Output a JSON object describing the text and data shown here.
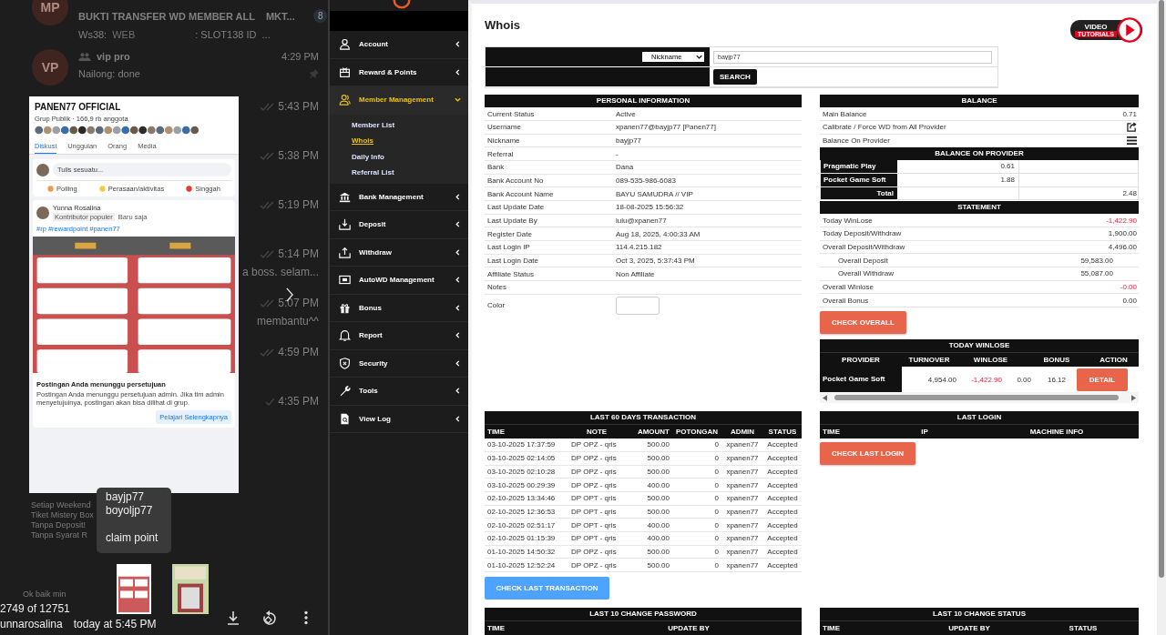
{
  "viewer": {
    "chats": [
      {
        "avatar": "MP",
        "title": "BUKTI TRANSFER WD MEMBER ALL",
        "title_2": "MKT...",
        "badge": "8",
        "preview": [
          "Ws38:",
          "WEB",
          ": SLOT138 ID",
          "..."
        ]
      },
      {
        "avatar": "VP",
        "title": "vip pro",
        "time": "4:29 PM",
        "preview": [
          "Nailong: done"
        ]
      }
    ],
    "messages": [
      {
        "time": "5:43 PM",
        "read": true
      },
      {
        "time": "5:38 PM",
        "read": true
      },
      {
        "time": "5:19 PM",
        "read": true
      },
      {
        "time": "5:14 PM",
        "read": true,
        "text": "a boss. selam..."
      },
      {
        "time": "5:07 PM",
        "read": true,
        "text": "membantu^^"
      },
      {
        "time": "4:59 PM",
        "read": true
      },
      {
        "time": "4:35 PM",
        "read": false
      }
    ],
    "behind_lines": [
      "Setiap Weekend",
      "Tiket Mistery Box",
      "Tanpa Deposit!",
      "Tanpa Syarat R"
    ],
    "reply": "Ok baik min",
    "post": {
      "group": "PANEN77 OFFICIAL",
      "meta": "Grup Publik · 166,9 rb anggota",
      "tabs": [
        {
          "label": "Diskusi",
          "selected": true
        },
        {
          "label": "Unggulan",
          "selected": false
        },
        {
          "label": "Orang",
          "selected": false
        },
        {
          "label": "Media",
          "selected": false
        }
      ],
      "composer": "Tulis sesuatu...",
      "actions": [
        {
          "label": "Polling",
          "kind": "poll"
        },
        {
          "label": "Perasaan/aktivitas",
          "kind": "feeling"
        },
        {
          "label": "Singgah",
          "kind": "location"
        }
      ],
      "author": "Yunna Rosalina",
      "badge": "Kontributor populer",
      "when": "Baru saja",
      "tags": "#rp #rewardpoint #panen77",
      "notice_title": "Postingan Anda menunggu persetujuan",
      "notice_text": "Postingan Anda menunggu persetujuan admin. Jika tim admin menyetujuinya, postingan akan bisa dilihat di grup.",
      "notice_button": "Pelajari Selengkapnya"
    },
    "caption_lines": [
      "bayjp77",
      "boyoljp77"
    ],
    "caption_note": "claim point",
    "counter": "2749 of 12751",
    "author": "unnarosalina",
    "date": "today at 5:45 PM"
  },
  "sidebar": {
    "items": [
      {
        "label": "Account",
        "kind": "account",
        "expanded": false
      },
      {
        "label": "Reward & Points",
        "kind": "reward",
        "expanded": false
      },
      {
        "label": "Member Management",
        "kind": "members",
        "expanded": true,
        "children": [
          {
            "label": "Member List",
            "selected": false
          },
          {
            "label": "Whois",
            "selected": true
          },
          {
            "label": "Daily Info",
            "selected": false
          },
          {
            "label": "Referral List",
            "selected": false
          }
        ]
      },
      {
        "label": "Bank Management",
        "kind": "bank",
        "expanded": false
      },
      {
        "label": "Deposit",
        "kind": "deposit",
        "expanded": false
      },
      {
        "label": "Withdraw",
        "kind": "withdraw",
        "expanded": false
      },
      {
        "label": "AutoWD Management",
        "kind": "autowd",
        "expanded": false
      },
      {
        "label": "Bonus",
        "kind": "bonus",
        "expanded": false
      },
      {
        "label": "Report",
        "kind": "report",
        "expanded": false
      },
      {
        "label": "Security",
        "kind": "security",
        "expanded": false
      },
      {
        "label": "Tools",
        "kind": "tools",
        "expanded": false
      },
      {
        "label": "View Log",
        "kind": "log",
        "expanded": false
      }
    ]
  },
  "page": {
    "title": "Whois",
    "tutorial_top": "VIDEO",
    "tutorial_bottom": "TUTORIALS"
  },
  "search": {
    "field": "Nickname",
    "value": "bayjp77",
    "button": "SEARCH"
  },
  "personal": {
    "title": "PERSONAL INFORMATION",
    "rows": [
      {
        "label": "Current Status",
        "value": "Active",
        "kind": "text"
      },
      {
        "label": "Username",
        "value": "xpanen77@bayjp77  [Panen77]",
        "kind": "text"
      },
      {
        "label": "Nickname",
        "value": "bayjp77",
        "kind": "text"
      },
      {
        "label": "Referral",
        "value": "-",
        "kind": "text"
      },
      {
        "label": "Bank",
        "value": "Dana",
        "kind": "text"
      },
      {
        "label": "Bank Account No",
        "value": "089-535-986-6083",
        "kind": "text"
      },
      {
        "label": "Bank Account Name",
        "value": "BAYU SAMUDRA // VIP",
        "kind": "text"
      },
      {
        "label": "Last Update Date",
        "value": "18-08-2025 15:56:32",
        "kind": "text"
      },
      {
        "label": "Last Update By",
        "value": "lulu@xpanen77",
        "kind": "text"
      },
      {
        "label": "Register Date",
        "value": "Aug 18, 2025, 4:00:33 AM",
        "kind": "text"
      },
      {
        "label": "Last Login IP",
        "value": "114.4.215.182",
        "kind": "text"
      },
      {
        "label": "Last Login Date",
        "value": "Oct 3, 2025, 5:37:43 PM",
        "kind": "text"
      },
      {
        "label": "Affiliate Status",
        "value": "Non Affiliate",
        "kind": "text"
      },
      {
        "label": "Notes",
        "kind": "text"
      },
      {
        "label": "Color",
        "kind": "color"
      }
    ]
  },
  "balance": {
    "title": "BALANCE",
    "rows": [
      {
        "label": "Main Balance",
        "value": "0.71",
        "kind": "text"
      },
      {
        "label": "Calibrate / Force WD from All Provider",
        "kind": "action"
      },
      {
        "label": "Balance On Provider",
        "kind": "list"
      }
    ]
  },
  "provider_balance": {
    "title": "BALANCE ON PROVIDER",
    "rows": [
      {
        "name": "Pragmatic Play",
        "value": "0.61"
      },
      {
        "name": "Pocket Game Soft",
        "value": "1.88"
      }
    ],
    "total_label": "Total",
    "total": "2.48"
  },
  "statement": {
    "title": "STATEMENT",
    "rows": [
      {
        "label": "Today WinLose",
        "value": "-1,422.90",
        "negative": true
      },
      {
        "label": "Today Deposit/Withdraw",
        "value": "1,900.00",
        "negative": false
      },
      {
        "label": "Overall Deposit/Withdraw",
        "value": "4,496.00",
        "negative": false,
        "children": [
          {
            "label": "Overall Deposit",
            "value": "59,583.00"
          },
          {
            "label": "Overall Withdraw",
            "value": "55,087.00"
          }
        ]
      },
      {
        "label": "Overall Winlose",
        "value": "-0.00",
        "negative": true
      },
      {
        "label": "Overall Bonus",
        "value": "0.00",
        "negative": false
      }
    ],
    "button": "CHECK OVERALL"
  },
  "today_winlose": {
    "title": "TODAY WINLOSE",
    "columns": [
      "PROVIDER",
      "TURNOVER",
      "WINLOSE",
      "BONUS",
      "ACTION"
    ],
    "rows": [
      {
        "provider": "Pocket Game Soft",
        "turnover": "4,954.00",
        "winlose": "-1,422.90",
        "column_4": "0.00",
        "bonus": "16.12",
        "action": "DETAIL"
      }
    ]
  },
  "transactions": {
    "title": "LAST 60 DAYS TRANSACTION",
    "columns": [
      "TIME",
      "NOTE",
      "AMOUNT",
      "POTONGAN",
      "ADMIN",
      "STATUS"
    ],
    "rows": [
      [
        "03-10-2025 17:37:59",
        "DP OPZ - qris",
        "500.00",
        "0",
        "xpanen77",
        "Accepted"
      ],
      [
        "03-10-2025 02:14:05",
        "DP OPZ - qris",
        "500.00",
        "0",
        "xpanen77",
        "Accepted"
      ],
      [
        "03-10-2025 02:10:28",
        "DP OPZ - qris",
        "500.00",
        "0",
        "xpanen77",
        "Accepted"
      ],
      [
        "03-10-2025 00:29:39",
        "DP OPZ - qris",
        "400.00",
        "0",
        "xpanen77",
        "Accepted"
      ],
      [
        "02-10-2025 13:34:46",
        "DP OPT - qris",
        "500.00",
        "0",
        "xpanen77",
        "Accepted"
      ],
      [
        "02-10-2025 12:36:53",
        "DP OPT - qris",
        "500.00",
        "0",
        "xpanen77",
        "Accepted"
      ],
      [
        "02-10-2025 02:51:17",
        "DP OPT - qris",
        "400.00",
        "0",
        "xpanen77",
        "Accepted"
      ],
      [
        "02-10-2025 01:15:39",
        "DP OPT - qris",
        "400.00",
        "0",
        "xpanen77",
        "Accepted"
      ],
      [
        "01-10-2025 14:50:32",
        "DP OPZ - qris",
        "500.00",
        "0",
        "xpanen77",
        "Accepted"
      ],
      [
        "01-10-2025 12:52:24",
        "DP OPZ - qris",
        "500.00",
        "0",
        "xpanen77",
        "Accepted"
      ]
    ],
    "button": "CHECK LAST TRANSACTION"
  },
  "last_login": {
    "title": "LAST LOGIN",
    "columns": [
      "TIME",
      "IP",
      "MACHINE INFO"
    ],
    "button": "CHECK LAST LOGIN"
  },
  "password_changes": {
    "title": "LAST 10 CHANGE PASSWORD",
    "columns": [
      "TIME",
      "UPDATE BY"
    ]
  },
  "status_changes": {
    "title": "LAST 10 CHANGE STATUS",
    "columns": [
      "TIME",
      "UPDATE BY",
      "STATUS"
    ]
  }
}
